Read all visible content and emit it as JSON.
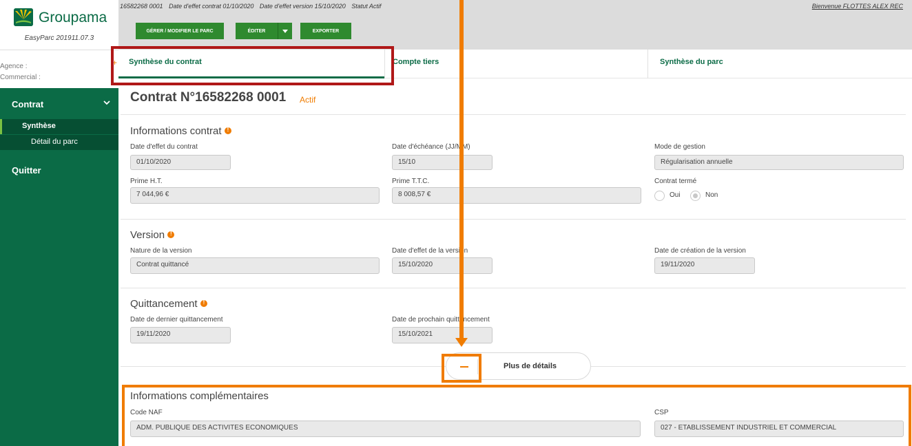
{
  "app": {
    "logo_text": "Groupama",
    "version": "EasyParc 201911.07.3",
    "agence_label": "Agence :",
    "commercial_label": "Commercial :"
  },
  "topbar": {
    "contract_no": "16582268 0001",
    "effet_contrat": "Date d'effet contrat 01/10/2020",
    "effet_version": "Date d'effet version 15/10/2020",
    "statut": "Statut Actif",
    "welcome": "Bienvenue FLOTTES ALEX REC",
    "buttons": {
      "gerer": "GÉRER / MODIFIER LE PARC",
      "editer": "ÉDITER",
      "exporter": "EXPORTER"
    }
  },
  "sidebar": {
    "contrat": "Contrat",
    "synthese": "Synthèse",
    "detail": "Détail du parc",
    "quitter": "Quitter"
  },
  "tabs": [
    "Synthèse du contrat",
    "Compte tiers",
    "Synthèse du parc"
  ],
  "main": {
    "title": "Contrat N°16582268 0001",
    "status": "Actif",
    "sections": {
      "info_contrat": "Informations contrat",
      "version": "Version",
      "quittancement": "Quittancement",
      "complementaires": "Informations complémentaires"
    },
    "fields": {
      "date_effet_contrat": {
        "label": "Date d'effet du contrat",
        "value": "01/10/2020"
      },
      "date_echeance": {
        "label": "Date d'échéance (JJ/MM)",
        "value": "15/10"
      },
      "mode_gestion": {
        "label": "Mode de gestion",
        "value": "Régularisation annuelle"
      },
      "prime_ht": {
        "label": "Prime H.T.",
        "value": "7 044,96 €"
      },
      "prime_ttc": {
        "label": "Prime T.T.C.",
        "value": "8 008,57 €"
      },
      "contrat_terme": {
        "label": "Contrat termé",
        "oui": "Oui",
        "non": "Non",
        "selected": "Non"
      },
      "nature_version": {
        "label": "Nature de la version",
        "value": "Contrat quittancé"
      },
      "date_effet_version": {
        "label": "Date d'effet de la version",
        "value": "15/10/2020"
      },
      "date_creation_version": {
        "label": "Date de création de la version",
        "value": "19/11/2020"
      },
      "dernier_quittancement": {
        "label": "Date de dernier quittancement",
        "value": "19/11/2020"
      },
      "prochain_quittancement": {
        "label": "Date de prochain quittancement",
        "value": "15/10/2021"
      },
      "code_naf": {
        "label": "Code NAF",
        "value": "ADM. PUBLIQUE DES ACTIVITES ECONOMIQUES"
      },
      "csp": {
        "label": "CSP",
        "value": "027 - ETABLISSEMENT INDUSTRIEL ET COMMERCIAL"
      }
    },
    "details_button": "Plus de détails"
  },
  "colors": {
    "brand_green": "#0b6b46",
    "button_green": "#2f8a2f",
    "accent_orange": "#f07c00",
    "highlight_red": "#b01818"
  }
}
